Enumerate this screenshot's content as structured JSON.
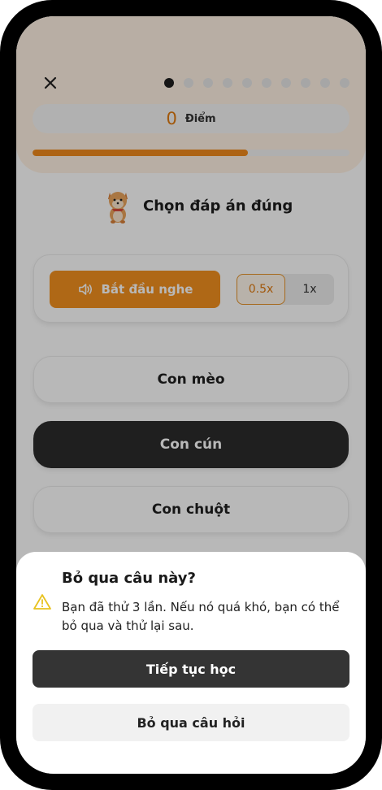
{
  "header": {
    "close_icon": "close-icon",
    "progress_dots": {
      "total": 10,
      "active_index": 0
    },
    "score": {
      "value": "0",
      "label": "Điểm"
    },
    "progress_fraction": 0.68,
    "accent_color": "#f08a1c"
  },
  "prompt": {
    "mascot_icon": "shiba-dog-mascot",
    "text": "Chọn đáp án đúng"
  },
  "audio": {
    "listen_label": "Bắt đầu nghe",
    "listen_icon": "speaker-icon",
    "speeds": [
      "0.5x",
      "1x"
    ],
    "selected_speed": "0.5x"
  },
  "options": [
    "Con mèo",
    "Con cún",
    "Con chuột"
  ],
  "selected_option": "Con cún",
  "dialog": {
    "title": "Bỏ qua câu này?",
    "icon": "warning-icon",
    "message": "Bạn đã thử 3 lần. Nếu nó quá khó, bạn có thể bỏ qua và thử lại sau.",
    "continue_label": "Tiếp tục học",
    "skip_label": "Bỏ qua câu hỏi"
  }
}
